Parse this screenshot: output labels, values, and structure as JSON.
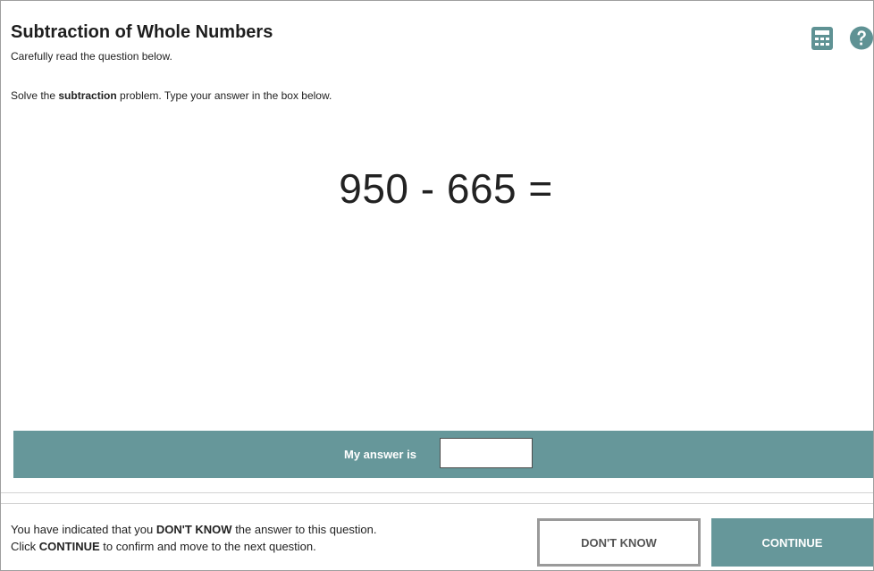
{
  "header": {
    "title": "Subtraction of Whole Numbers",
    "subtitle": "Carefully read the question below."
  },
  "tools": {
    "calculator_icon": "calculator-icon",
    "help_icon": "help-icon"
  },
  "question": {
    "instruction_prefix": "Solve the ",
    "instruction_emphasis": "subtraction",
    "instruction_suffix": " problem. Type your answer in the box below.",
    "equation": "950 - 665 ="
  },
  "answer": {
    "label": "My answer is",
    "value": ""
  },
  "footer": {
    "line1_prefix": "You have indicated that you ",
    "line1_emphasis": "DON'T KNOW",
    "line1_suffix": " the answer to this question.",
    "line2_prefix": "Click ",
    "line2_emphasis": "CONTINUE",
    "line2_suffix": " to confirm and move to the next question.",
    "dont_know_label": "DON'T KNOW",
    "continue_label": "CONTINUE"
  },
  "colors": {
    "accent": "#66979a",
    "icon": "#5f9294",
    "button_border": "#9a9a9a"
  }
}
